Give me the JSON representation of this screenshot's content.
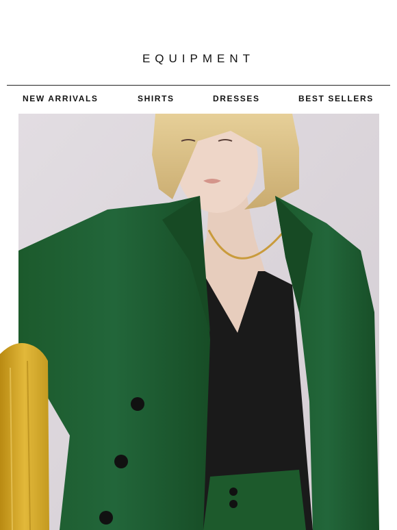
{
  "brand": {
    "name": "EQUIPMENT"
  },
  "nav": {
    "items": [
      {
        "label": "NEW ARRIVALS"
      },
      {
        "label": "SHIRTS"
      },
      {
        "label": "DRESSES"
      },
      {
        "label": "BEST SELLERS"
      }
    ]
  },
  "hero": {
    "image": "model-in-green-blazer-photo",
    "decoration": "gold-brush-stroke"
  },
  "colors": {
    "background": "#ffffff",
    "text": "#111111",
    "blazer_green": "#1f5a2e",
    "top_black": "#1a1a1a",
    "backdrop": "#dcd6dc",
    "gold": "#d4a521"
  }
}
